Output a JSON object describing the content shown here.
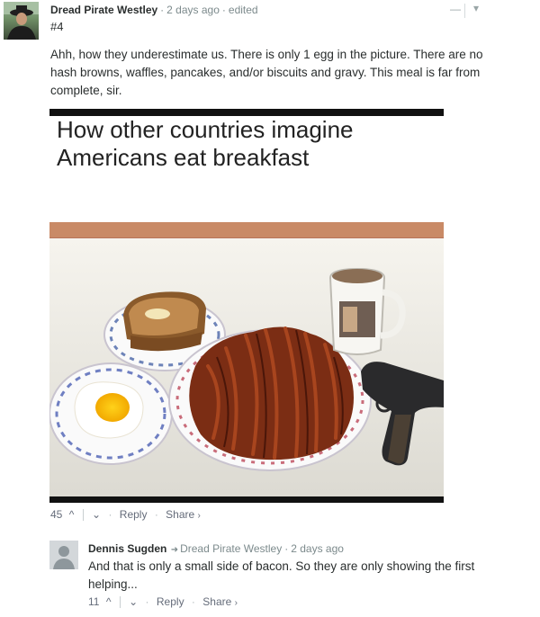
{
  "comment": {
    "author": "Dread Pirate Westley",
    "time": "2 days ago",
    "edited": "edited",
    "number": "#4",
    "text": "Ahh, how they underestimate us. There is only 1 egg in the picture. There are no hash browns, waffles, pancakes, and/or biscuits and gravy. This meal is far from complete, sir.",
    "image_caption_line1": "How other countries imagine",
    "image_caption_line2": "Americans eat breakfast",
    "votes": "45",
    "reply_label": "Reply",
    "share_label": "Share",
    "collapse_glyph": "—",
    "menu_glyph": "▾"
  },
  "reply": {
    "author": "Dennis Sugden",
    "reply_to": "Dread Pirate Westley",
    "time": "2 days ago",
    "text": "And that is only a small side of bacon. So they are only showing the first helping...",
    "votes": "11",
    "reply_label": "Reply",
    "share_label": "Share"
  },
  "glyphs": {
    "upvote": "^",
    "downvote": "⌄",
    "dot": "·",
    "share_arrow": "›",
    "reply_arrow": "➜"
  }
}
